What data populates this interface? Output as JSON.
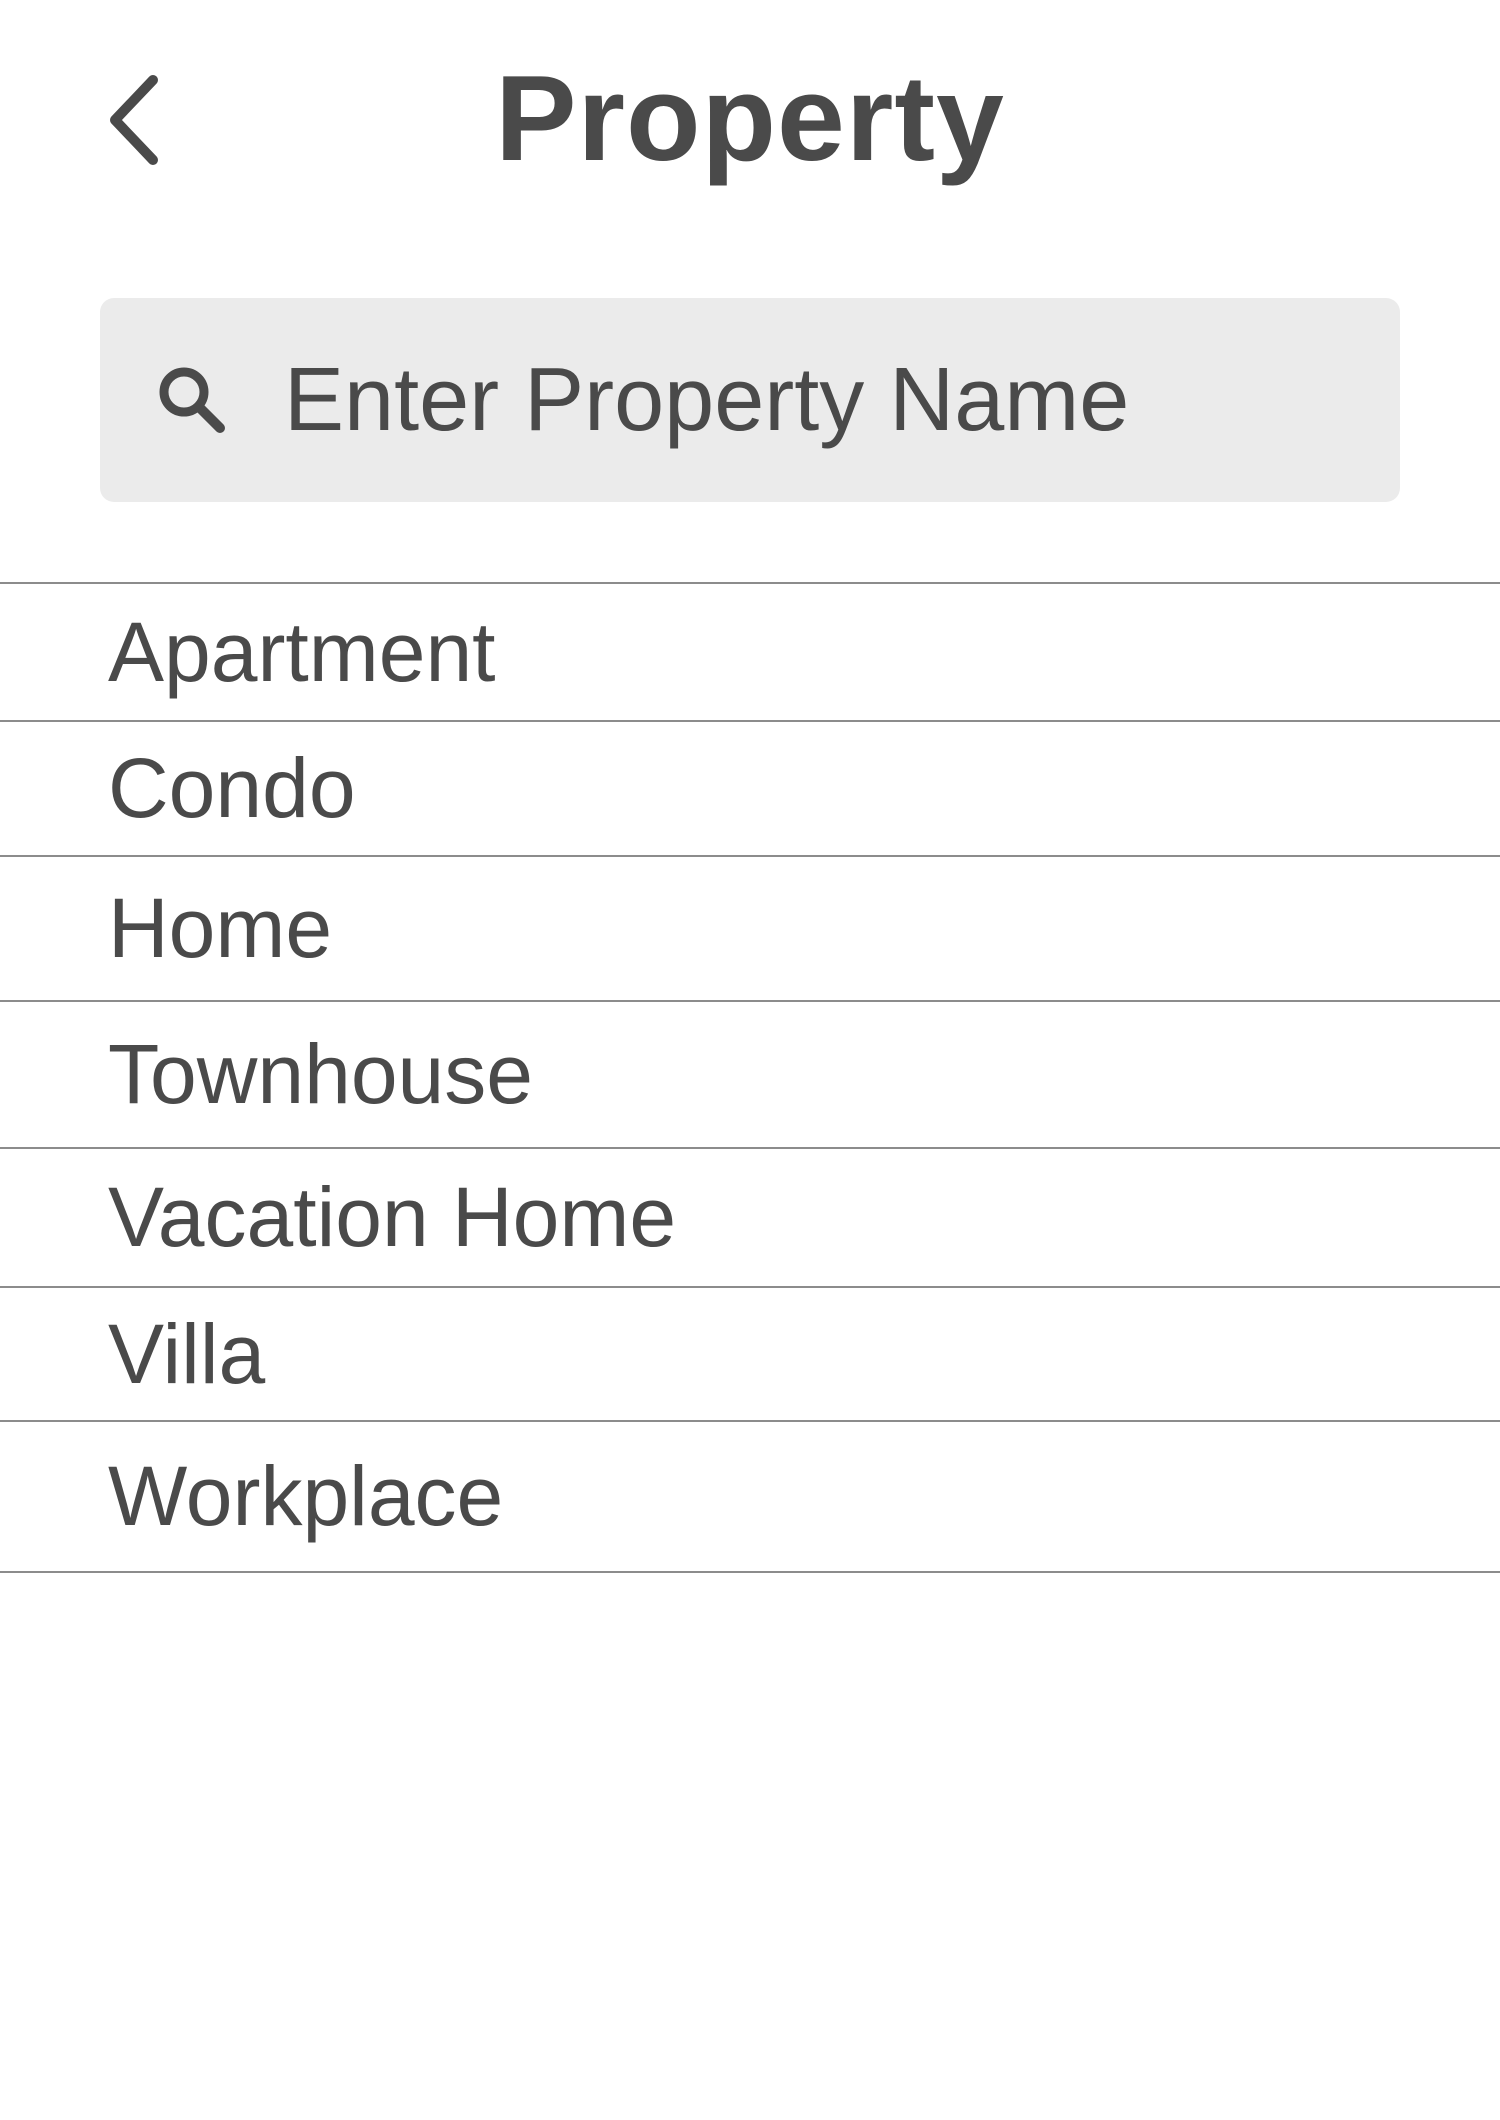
{
  "header": {
    "title": "Property",
    "back_icon": "chevron-left-icon"
  },
  "search": {
    "placeholder": "Enter Property Name",
    "value": "",
    "icon": "search-icon"
  },
  "list": {
    "items": [
      {
        "label": "Apartment"
      },
      {
        "label": "Condo"
      },
      {
        "label": "Home"
      },
      {
        "label": "Townhouse"
      },
      {
        "label": "Vacation Home"
      },
      {
        "label": "Villa"
      },
      {
        "label": "Workplace"
      }
    ]
  },
  "colors": {
    "text": "#4a4a4a",
    "search_background": "#ebebeb",
    "divider": "#8c8c8c",
    "background": "#ffffff"
  }
}
